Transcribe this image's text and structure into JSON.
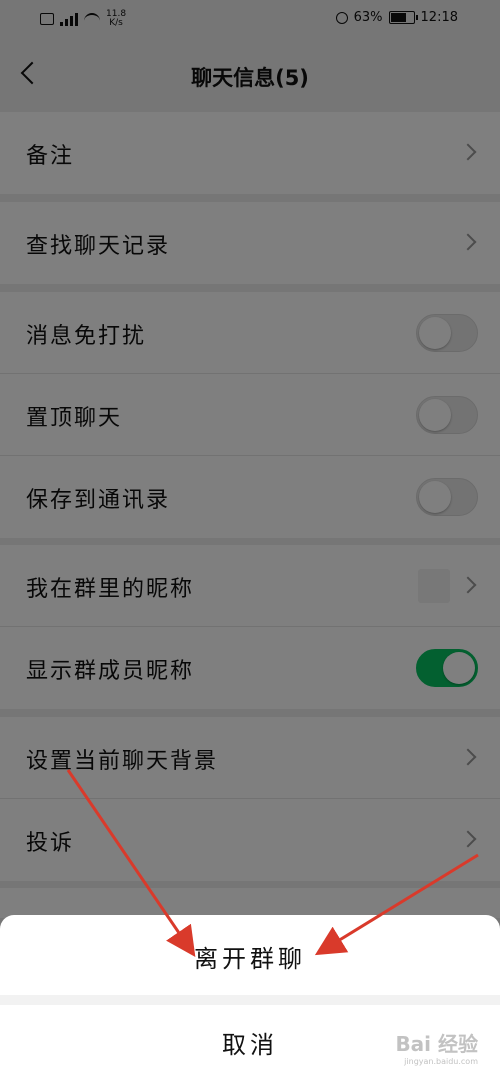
{
  "status_bar": {
    "net_speed": "11.8",
    "net_unit": "K/s",
    "battery": "63%",
    "time": "12:18",
    "icons": [
      "notification-icon",
      "signal-icon",
      "wifi-icon",
      "alarm-icon",
      "battery-icon"
    ]
  },
  "nav": {
    "title": "聊天信息(5)"
  },
  "groups": {
    "g1": {
      "remark": "备注"
    },
    "g2": {
      "search": "查找聊天记录"
    },
    "g3": {
      "mute": "消息免打扰",
      "pin": "置顶聊天",
      "save": "保存到通讯录"
    },
    "g4": {
      "nickname": "我在群里的昵称",
      "show_nick": "显示群成员昵称"
    },
    "g5": {
      "background": "设置当前聊天背景",
      "report": "投诉"
    }
  },
  "toggles": {
    "mute": false,
    "pin": false,
    "save": false,
    "show_nick": true
  },
  "sheet": {
    "leave": "离开群聊",
    "cancel": "取消"
  },
  "watermark": {
    "brand": "Bai 经验",
    "url": "jingyan.baidu.com"
  },
  "colors": {
    "accent": "#07c160",
    "arrow": "#d93a2b"
  }
}
